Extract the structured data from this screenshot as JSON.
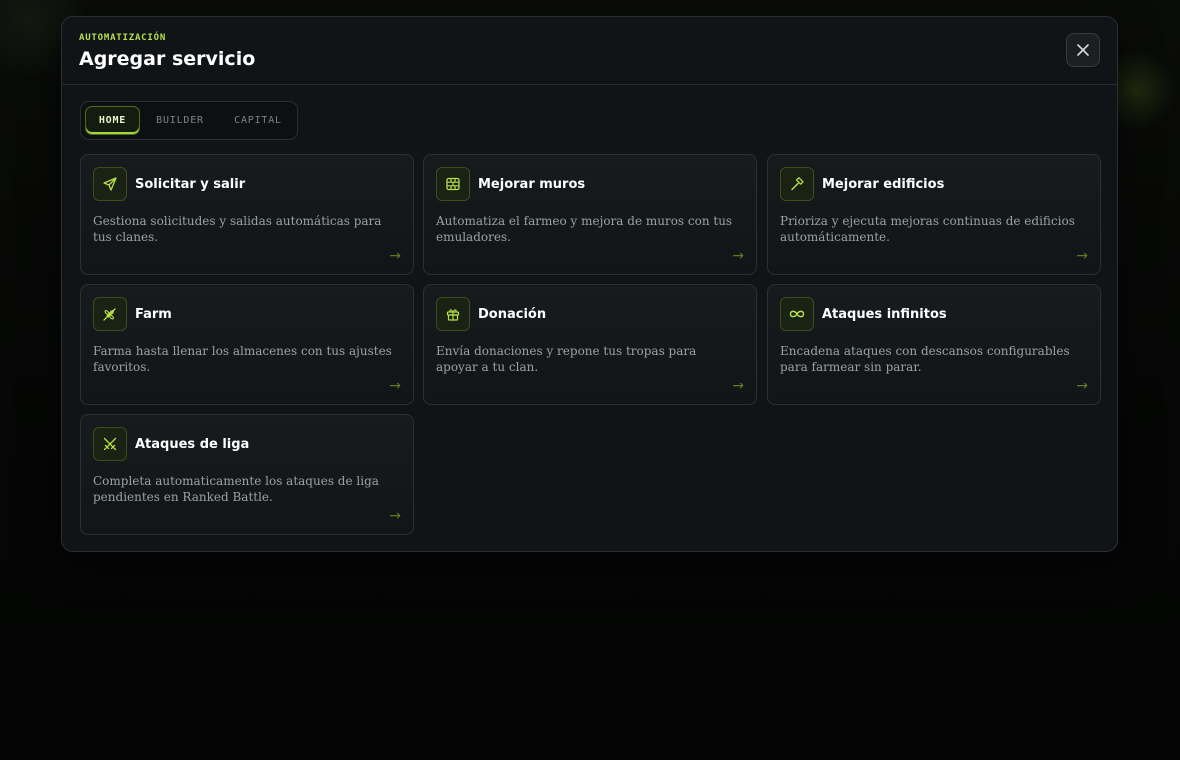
{
  "modal": {
    "eyebrow": "AUTOMATIZACIÓN",
    "title": "Agregar servicio",
    "close_icon": "close-icon"
  },
  "tabs": [
    {
      "label": "HOME",
      "active": true
    },
    {
      "label": "BUILDER",
      "active": false
    },
    {
      "label": "CAPITAL",
      "active": false
    }
  ],
  "services": [
    {
      "title": "Solicitar y salir",
      "icon": "send-icon",
      "description": "Gestiona solicitudes y salidas automáticas para tus clanes.",
      "arrow": "→"
    },
    {
      "title": "Mejorar muros",
      "icon": "brick-wall-icon",
      "description": "Automatiza el farmeo y mejora de muros con tus emuladores.",
      "arrow": "→"
    },
    {
      "title": "Mejorar edificios",
      "icon": "hammer-icon",
      "description": "Prioriza y ejecuta mejoras continuas de edificios automáticamente.",
      "arrow": "→"
    },
    {
      "title": "Farm",
      "icon": "wheat-icon",
      "description": "Farma hasta llenar los almacenes con tus ajustes favoritos.",
      "arrow": "→"
    },
    {
      "title": "Donación",
      "icon": "gift-icon",
      "description": "Envía donaciones y repone tus tropas para apoyar a tu clan.",
      "arrow": "→"
    },
    {
      "title": "Ataques infinitos",
      "icon": "infinity-icon",
      "description": "Encadena ataques con descansos configurables para farmear sin parar.",
      "arrow": "→"
    },
    {
      "title": "Ataques de liga",
      "icon": "swords-icon",
      "description": "Completa automaticamente los ataques de liga pendientes en Ranked Battle.",
      "arrow": "→"
    }
  ],
  "colors": {
    "accent": "#b5e04a",
    "background": "#111416"
  }
}
